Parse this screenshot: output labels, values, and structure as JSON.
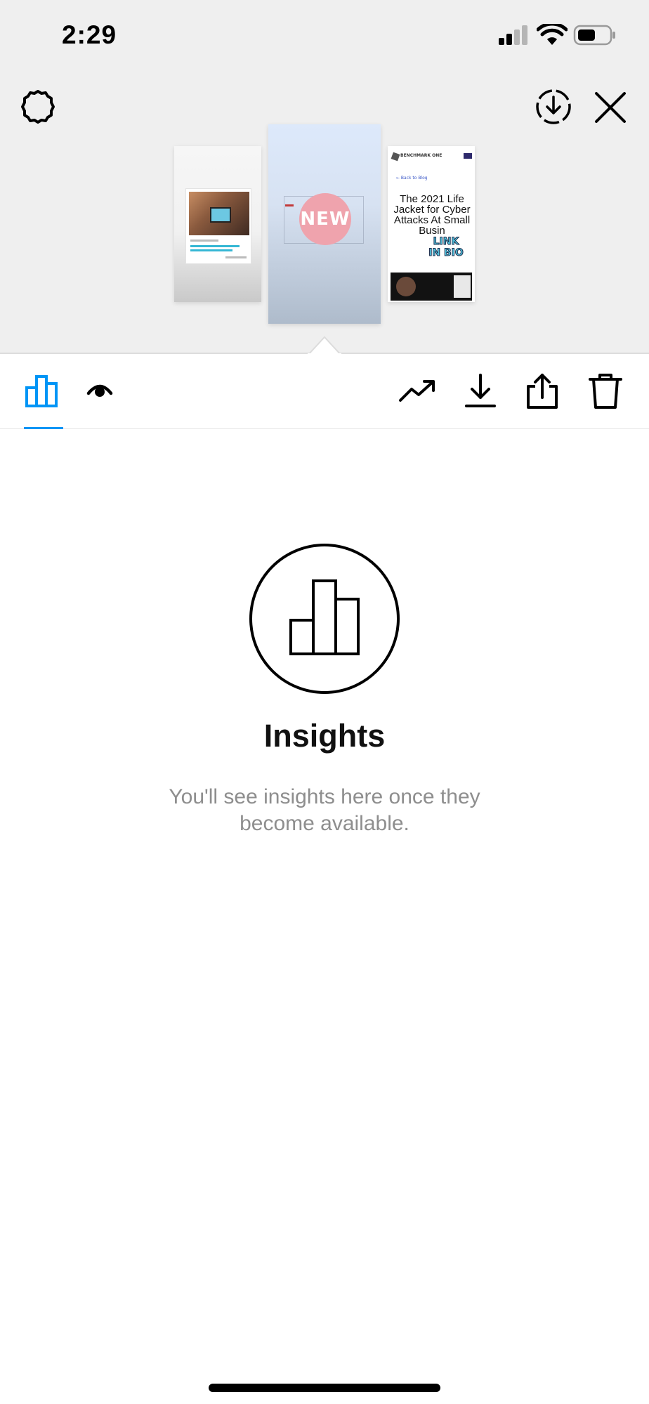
{
  "status_bar": {
    "time": "2:29"
  },
  "top_controls": {
    "settings_icon": "gear-icon",
    "save_icon": "circle-download-icon",
    "close_icon": "close-icon"
  },
  "stories": {
    "right_preview": {
      "brand": "BENCHMARK ONE",
      "back_link": "← Back to Blog",
      "title": "The 2021 Life Jacket for Cyber Attacks At Small Busin",
      "sticker": "LINK IN BIO"
    },
    "center_preview": {
      "sticker": "NEW"
    }
  },
  "toolbar": {
    "tabs": [
      {
        "name": "insights",
        "icon": "bar-chart-icon",
        "active": true
      },
      {
        "name": "viewers",
        "icon": "eye-icon",
        "active": false
      }
    ],
    "actions": [
      {
        "name": "boost",
        "icon": "trending-up-icon"
      },
      {
        "name": "download",
        "icon": "download-icon"
      },
      {
        "name": "share",
        "icon": "share-icon"
      },
      {
        "name": "delete",
        "icon": "trash-icon"
      }
    ],
    "accent_color": "#0095f6"
  },
  "empty_state": {
    "icon": "bar-chart-circle-icon",
    "title": "Insights",
    "subtitle": "You'll see insights here once they become available."
  }
}
